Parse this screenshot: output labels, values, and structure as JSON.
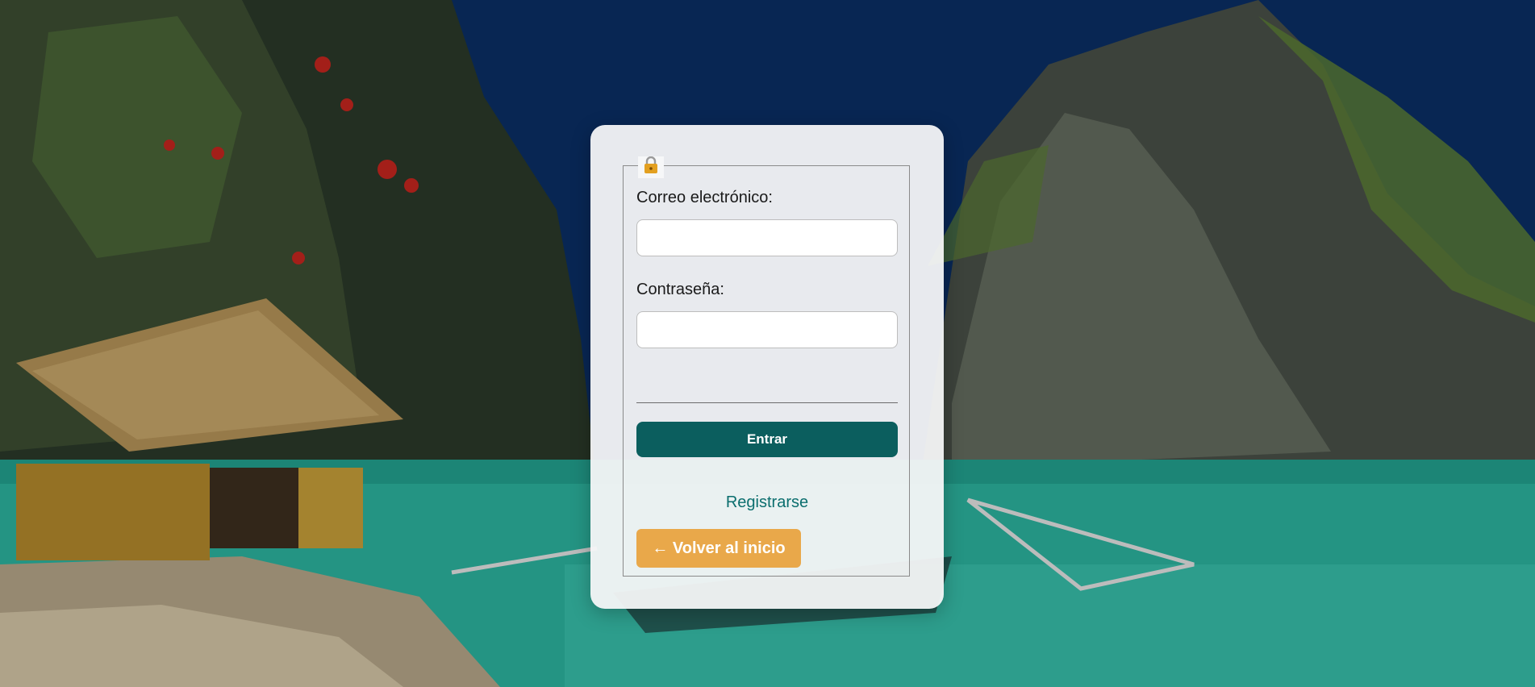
{
  "background": {
    "description_icon": "tropical-lagoon-image"
  },
  "form": {
    "legend_icon": "lock-icon",
    "email_label": "Correo electrónico:",
    "email_value": "",
    "email_placeholder": "",
    "password_label": "Contraseña:",
    "password_value": "",
    "password_placeholder": "",
    "submit_label": "Entrar",
    "register_link": "Registrarse",
    "back_button": "← Volver al inicio"
  },
  "colors": {
    "primary": "#0b5e5e",
    "link": "#0b6e6e",
    "back_button": "#e9a84a",
    "card_bg": "#f6f7f8"
  }
}
